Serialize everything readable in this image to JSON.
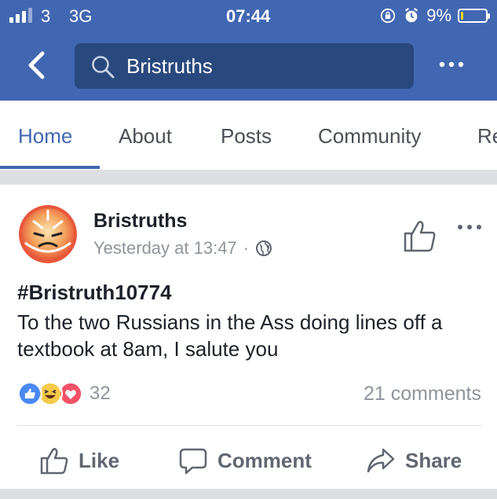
{
  "status_bar": {
    "carrier": "3",
    "network": "3G",
    "time": "07:44",
    "battery": "9%",
    "battery_level": 0.09,
    "signal_bars_filled": 3,
    "signal_bars_total": 4
  },
  "header": {
    "search_text": "Bristruths",
    "bg_color": "#4267b2",
    "icons": [
      "back-arrow-icon",
      "search-icon",
      "more-icon"
    ]
  },
  "tabs": [
    {
      "label": "Home",
      "active": true
    },
    {
      "label": "About",
      "active": false
    },
    {
      "label": "Posts",
      "active": false
    },
    {
      "label": "Community",
      "active": false
    },
    {
      "label": "Re",
      "active": false
    }
  ],
  "post": {
    "page_name": "Bristruths",
    "timestamp": "Yesterday at 13:47",
    "separator": "·",
    "hashtag": "#Bristruth10774",
    "text": "To the two Russians in the Ass doing lines off a textbook at 8am, I salute you",
    "reaction_count": "32",
    "reactions": [
      "like",
      "haha",
      "love"
    ],
    "comments": "21 comments"
  },
  "actions": {
    "like": "Like",
    "comment": "Comment",
    "share": "Share"
  }
}
